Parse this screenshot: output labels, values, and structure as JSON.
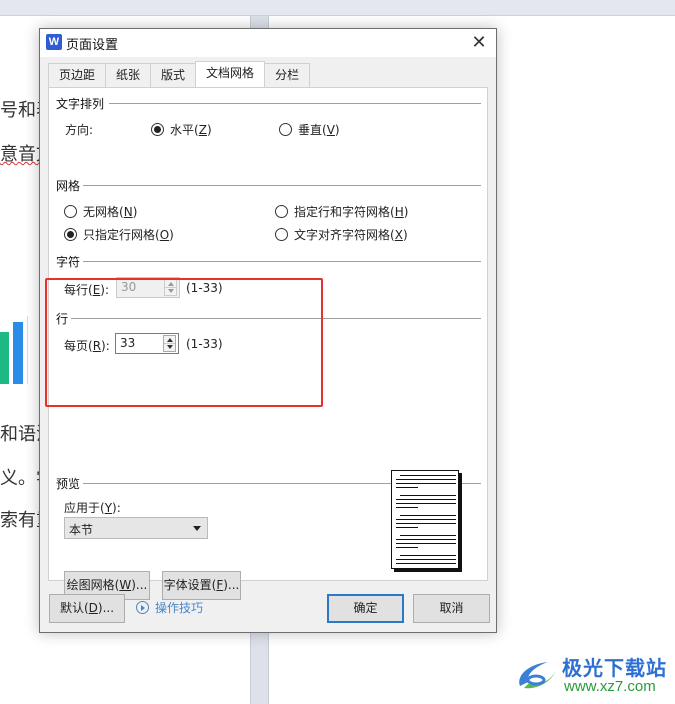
{
  "background_document": {
    "left_page_lines": [
      {
        "text": "号和表"
      },
      {
        "text": "意音文"
      },
      {
        "text": "和语法"
      },
      {
        "text": "义。学"
      },
      {
        "text": "索有重"
      }
    ]
  },
  "dialog": {
    "app_icon_letter": "W",
    "title": "页面设置",
    "close_glyph": "✕",
    "tabs": [
      {
        "label": "页边距",
        "active": false
      },
      {
        "label": "纸张",
        "active": false
      },
      {
        "label": "版式",
        "active": false
      },
      {
        "label": "文档网格",
        "active": true
      },
      {
        "label": "分栏",
        "active": false
      }
    ],
    "text_direction": {
      "section_label": "文字排列",
      "direction_label": "方向:",
      "options": [
        {
          "label": "水平",
          "accel": "Z",
          "selected": true
        },
        {
          "label": "垂直",
          "accel": "V",
          "selected": false
        }
      ]
    },
    "grid": {
      "section_label": "网格",
      "options": [
        {
          "label": "无网格",
          "accel": "N",
          "selected": false
        },
        {
          "label": "指定行和字符网格",
          "accel": "H",
          "selected": false
        },
        {
          "label": "只指定行网格",
          "accel": "O",
          "selected": true
        },
        {
          "label": "文字对齐字符网格",
          "accel": "X",
          "selected": false
        }
      ]
    },
    "characters": {
      "section_label": "字符",
      "per_line_label": "每行",
      "per_line_accel": "E",
      "per_line_value": "30",
      "per_line_range": "(1-33)",
      "disabled": true
    },
    "lines": {
      "section_label": "行",
      "per_page_label": "每页",
      "per_page_accel": "R",
      "per_page_value": "33",
      "per_page_range": "(1-33)"
    },
    "preview": {
      "section_label": "预览",
      "apply_to_label": "应用于",
      "apply_to_accel": "Y",
      "apply_to_value": "本节"
    },
    "buttons": {
      "drawing_grid": "绘图网格(W)...",
      "drawing_grid_pre": "绘图网格(",
      "drawing_grid_accel": "W",
      "drawing_grid_post": ")...",
      "font_settings_pre": "字体设置(",
      "font_settings_accel": "F",
      "font_settings_post": ")...",
      "default_pre": "默认(",
      "default_accel": "D",
      "default_post": ")...",
      "tips": "操作技巧",
      "ok": "确定",
      "cancel": "取消"
    },
    "highlight_color": "#e5322d"
  },
  "watermark": {
    "title": "极光下载站",
    "url": "www.xz7.com"
  }
}
